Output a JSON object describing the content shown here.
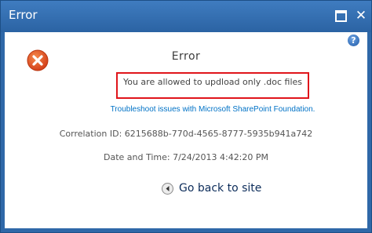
{
  "window": {
    "title": "Error",
    "maximize_icon": "maximize-icon",
    "close_glyph": "✕",
    "title_bar_color": "#2f68a8"
  },
  "help": {
    "glyph": "?",
    "icon": "help-icon"
  },
  "error": {
    "icon": "error-x-icon",
    "icon_color": "#e05a25",
    "heading": "Error",
    "message": "You are allowed to updload only .doc files",
    "highlight_color": "#e0151b",
    "troubleshoot_link": "Troubleshoot issues with Microsoft SharePoint Foundation.",
    "correlation": "Correlation ID: 6215688b-770d-4565-8777-5935b941a742",
    "datetime": "Date and Time: 7/24/2013 4:42:20 PM"
  },
  "navigation": {
    "back_icon": "back-arrow-icon",
    "back_label": "Go back to site"
  }
}
